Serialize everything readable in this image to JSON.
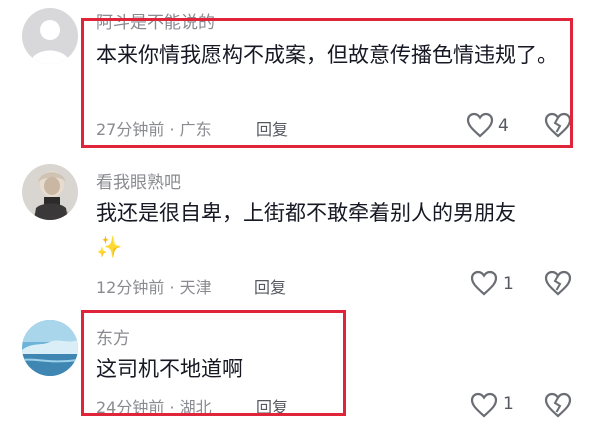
{
  "comments": [
    {
      "username": "阿斗是不能说的",
      "text": "本来你情我愿构不成案，但故意传播色情违规了。",
      "time_location": "27分钟前 · 广东",
      "reply_label": "回复",
      "likes": "4",
      "avatar": "default-avatar"
    },
    {
      "username": "看我眼熟吧",
      "text": "我还是很自卑，上街都不敢牵着别人的男朋友",
      "emoji": "✨",
      "time_location": "12分钟前 · 天津",
      "reply_label": "回复",
      "likes": "1",
      "avatar": "photo-avatar"
    },
    {
      "username": "东方",
      "text": "这司机不地道啊",
      "time_location": "24分钟前 · 湖北",
      "reply_label": "回复",
      "likes": "1",
      "avatar": "landscape-avatar"
    }
  ],
  "colors": {
    "highlight_box": "#e0243a",
    "meta_text": "#8a8b91",
    "body_text": "#161823"
  }
}
